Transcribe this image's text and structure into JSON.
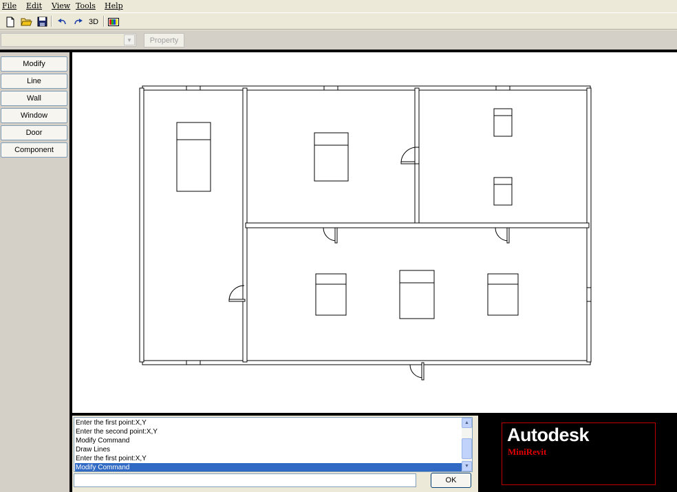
{
  "menu": [
    "File",
    "Edit",
    "View",
    "Tools",
    "Help"
  ],
  "toolbar": {
    "new_icon": "new-file-icon",
    "open_icon": "open-folder-icon",
    "save_icon": "save-disk-icon",
    "undo_icon": "undo-icon",
    "redo_icon": "redo-icon",
    "view3d_label": "3D",
    "color_icon": "color-palette-icon"
  },
  "property_bar": {
    "selector_value": "",
    "property_label": "Property"
  },
  "tools": [
    "Modify",
    "Line",
    "Wall",
    "Window",
    "Door",
    "Component"
  ],
  "command_log": [
    {
      "text": "Enter the first point:X,Y",
      "selected": false
    },
    {
      "text": "Enter the second point:X,Y",
      "selected": false
    },
    {
      "text": "Modify Command",
      "selected": false
    },
    {
      "text": "Draw Lines",
      "selected": false
    },
    {
      "text": "Enter the first point:X,Y",
      "selected": false
    },
    {
      "text": "Modify Command",
      "selected": true
    }
  ],
  "command_input": {
    "value": ""
  },
  "ok_label": "OK",
  "logo": {
    "brand": "Autodesk",
    "product": "MiniRevit",
    "accent_color": "#c00000"
  }
}
